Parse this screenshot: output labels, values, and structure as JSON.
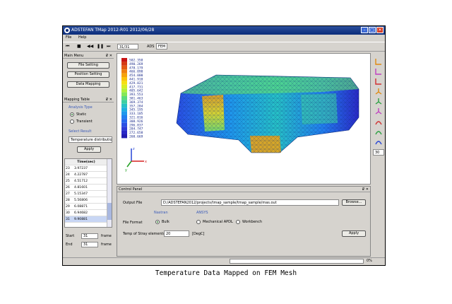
{
  "window": {
    "title": "ADSTEFAN TMap 2012-R01 2012/06/28",
    "menu": [
      "File",
      "Help"
    ]
  },
  "toolbar": {
    "frame_value": "31/31",
    "tab_label": "ADS",
    "active_tab": "FEM"
  },
  "main_menu": {
    "header": "Main Menu",
    "buttons": [
      "File Setting",
      "Position Setting",
      "Data Mapping"
    ]
  },
  "mapping_table": {
    "header": "Mapping Table",
    "analysis_type_label": "Analysis Type",
    "analysis_options": [
      "Static",
      "Transient"
    ],
    "analysis_selected": "Static",
    "select_result_label": "Select Result",
    "result_value": "Temperature distributio",
    "apply_label": "Apply",
    "column_header": "Time(sec)",
    "rows": [
      {
        "n": "23",
        "v": "3.97237"
      },
      {
        "n": "24",
        "v": "4.22787"
      },
      {
        "n": "25",
        "v": "4.51712"
      },
      {
        "n": "26",
        "v": "4.81601"
      },
      {
        "n": "27",
        "v": "5.15347"
      },
      {
        "n": "28",
        "v": "5.56806"
      },
      {
        "n": "29",
        "v": "6.08871"
      },
      {
        "n": "30",
        "v": "6.94682"
      },
      {
        "n": "31",
        "v": "9.90881"
      }
    ],
    "start_label": "Start",
    "start_value": "31",
    "end_label": "End",
    "end_value": "31",
    "frame_unit": "frame"
  },
  "legend": {
    "values": [
      "502.358",
      "490.269",
      "478.179",
      "466.090",
      "454.000",
      "441.910",
      "429.821",
      "417.731",
      "405.642",
      "393.553",
      "381.463",
      "369.374",
      "357.284",
      "345.195",
      "333.105",
      "321.016",
      "308.926",
      "296.837",
      "284.747",
      "272.658",
      "260.669"
    ],
    "colors": [
      "#c81414",
      "#d43a14",
      "#e25a14",
      "#ee7f10",
      "#f6a20c",
      "#fbc30a",
      "#f5e012",
      "#d8ee22",
      "#b2f03a",
      "#86e858",
      "#5cdc7c",
      "#3ccfa2",
      "#26c1c6",
      "#1eaee0",
      "#1f98ec",
      "#227ff0",
      "#2567ee",
      "#2a4fe4",
      "#2c3ad6",
      "#2a28c6",
      "#221cb0"
    ]
  },
  "triad": {
    "z": "z",
    "x": "x",
    "y": "y"
  },
  "right_toolbar": {
    "zoom_value": "30",
    "icons": [
      "view-xy-icon",
      "view-yz-icon",
      "view-zx-icon",
      "view-iso1-icon",
      "view-iso2-icon",
      "view-iso3-icon",
      "rotate-x-icon",
      "rotate-y-icon",
      "rotate-z-icon"
    ]
  },
  "control_panel": {
    "header": "Control Panel",
    "output_file_label": "Output File",
    "output_file_value": "D:/ADSTEFAN2012/projects/tmap_sample/tmap_sample/mas.out",
    "browse_label": "Browse...",
    "nastran_label": "Nastran",
    "ansys_label": "ANSYS",
    "file_format_label": "File Format",
    "formats": [
      "Bulk",
      "Mechanical APDL",
      "Workbench"
    ],
    "format_selected": "Bulk",
    "stray_label": "Temp of Stray elements",
    "stray_value": "20",
    "stray_unit": "[DegC]",
    "apply_label": "Apply"
  },
  "status": {
    "percent": "0%"
  },
  "caption": "Temperature Data Mapped on FEM Mesh"
}
